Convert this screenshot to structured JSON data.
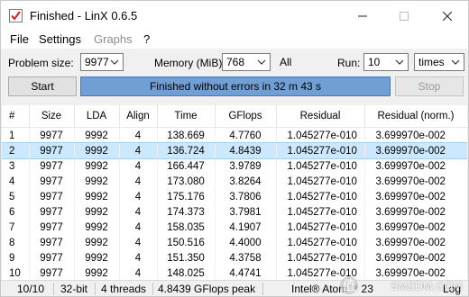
{
  "window": {
    "title": "Finished - LinX 0.6.5",
    "controls": {
      "minimize": "—",
      "maximize": "☐",
      "close": "✕"
    }
  },
  "menu": {
    "file": "File",
    "settings": "Settings",
    "graphs": "Graphs",
    "help": "?"
  },
  "controls": {
    "problem_size_label": "Problem size:",
    "problem_size_value": "9977",
    "memory_label": "Memory (MiB):",
    "memory_value": "768",
    "memory_all": "All",
    "run_label": "Run:",
    "run_value": "10",
    "run_unit": "times",
    "start_label": "Start",
    "status_text": "Finished without errors in 32 m 43 s",
    "stop_label": "Stop"
  },
  "table": {
    "headers": [
      "#",
      "Size",
      "LDA",
      "Align",
      "Time",
      "GFlops",
      "Residual",
      "Residual (norm.)"
    ],
    "rows": [
      [
        "1",
        "9977",
        "9992",
        "4",
        "138.669",
        "4.7760",
        "1.045277e-010",
        "3.699970e-002"
      ],
      [
        "2",
        "9977",
        "9992",
        "4",
        "136.724",
        "4.8439",
        "1.045277e-010",
        "3.699970e-002"
      ],
      [
        "3",
        "9977",
        "9992",
        "4",
        "166.447",
        "3.9789",
        "1.045277e-010",
        "3.699970e-002"
      ],
      [
        "4",
        "9977",
        "9992",
        "4",
        "173.080",
        "3.8264",
        "1.045277e-010",
        "3.699970e-002"
      ],
      [
        "5",
        "9977",
        "9992",
        "4",
        "175.176",
        "3.7806",
        "1.045277e-010",
        "3.699970e-002"
      ],
      [
        "6",
        "9977",
        "9992",
        "4",
        "174.373",
        "3.7981",
        "1.045277e-010",
        "3.699970e-002"
      ],
      [
        "7",
        "9977",
        "9992",
        "4",
        "158.035",
        "4.1907",
        "1.045277e-010",
        "3.699970e-002"
      ],
      [
        "8",
        "9977",
        "9992",
        "4",
        "150.516",
        "4.4000",
        "1.045277e-010",
        "3.699970e-002"
      ],
      [
        "9",
        "9977",
        "9992",
        "4",
        "151.350",
        "4.3758",
        "1.045277e-010",
        "3.699970e-002"
      ],
      [
        "10",
        "9977",
        "9992",
        "4",
        "148.025",
        "4.4741",
        "1.045277e-010",
        "3.699970e-002"
      ]
    ],
    "selected_row": 2
  },
  "status": {
    "progress": "10/10",
    "bits": "32-bit",
    "threads": "4 threads",
    "peak": "4.8439 GFlops peak",
    "cpu": "Intel® Atom™ 23",
    "log": "Log"
  },
  "watermark": {
    "badge": "值",
    "text": "SMZDM.COM"
  },
  "colors": {
    "accent": "#6f9fd4",
    "selection": "#cce8ff"
  }
}
